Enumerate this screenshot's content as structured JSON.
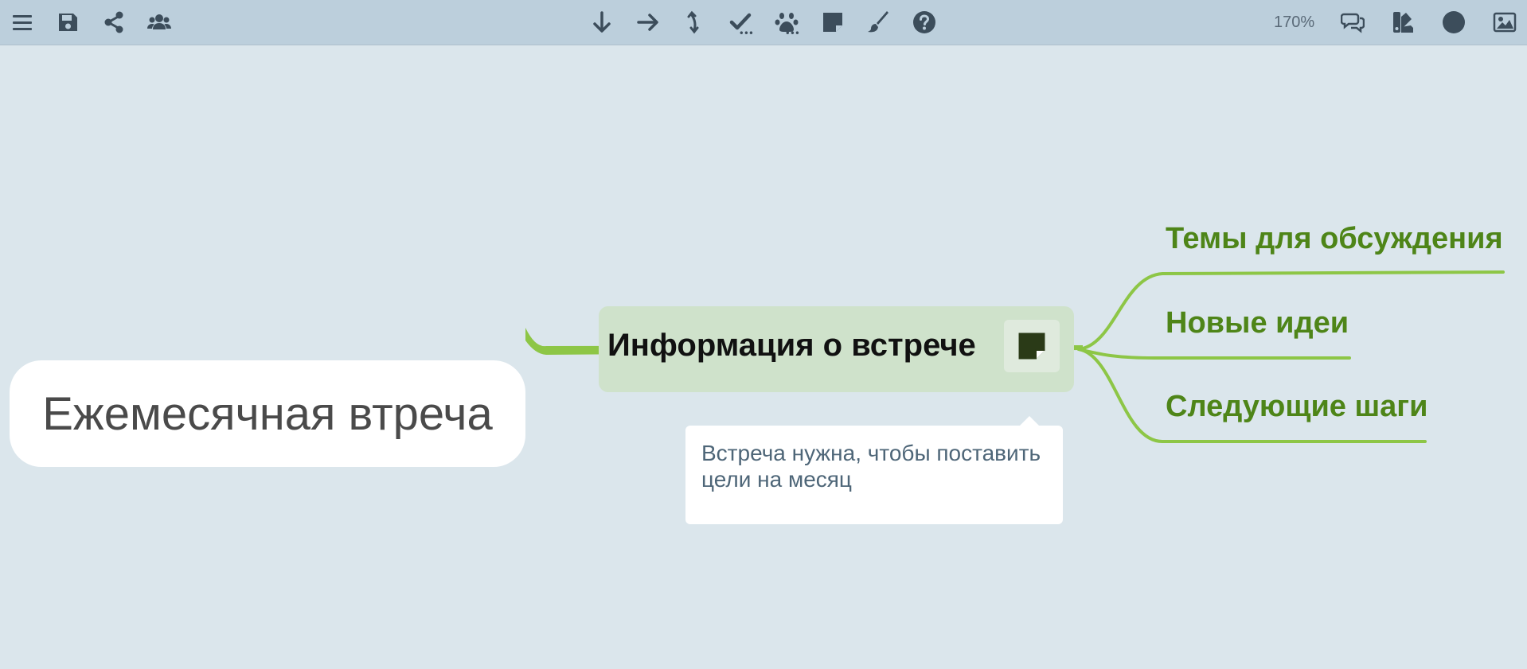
{
  "toolbar": {
    "left_buttons": [
      {
        "icon": "menu-icon"
      },
      {
        "icon": "save-icon"
      },
      {
        "icon": "share-icon"
      },
      {
        "icon": "users-icon"
      }
    ],
    "center_buttons": [
      {
        "icon": "arrow-down-icon"
      },
      {
        "icon": "arrow-right-icon"
      },
      {
        "icon": "connect-arrow-icon"
      },
      {
        "icon": "checkmark-icon"
      },
      {
        "icon": "paw-icon"
      },
      {
        "icon": "sticky-note-icon"
      },
      {
        "icon": "brush-icon"
      },
      {
        "icon": "help-icon"
      }
    ],
    "zoom_label": "170%",
    "right_buttons": [
      {
        "icon": "comments-icon"
      },
      {
        "icon": "swatches-icon"
      },
      {
        "icon": "circle-icon"
      },
      {
        "icon": "image-icon"
      }
    ]
  },
  "mindmap": {
    "root": {
      "label": "Ежемесячная втреча"
    },
    "main_topic": {
      "label": "Информация о встрече",
      "note": "Встреча нужна, чтобы поставить цели на месяц"
    },
    "subtopics": [
      {
        "label": "Темы для обсуждения"
      },
      {
        "label": "Новые идеи"
      },
      {
        "label": "Следующие шаги"
      }
    ]
  },
  "colors": {
    "background": "#dbe6ec",
    "toolbar": "#bccfdc",
    "branch": "#8dc646",
    "subtopic_text": "#4e8518",
    "main_topic_fill": "#cfe2cb"
  }
}
